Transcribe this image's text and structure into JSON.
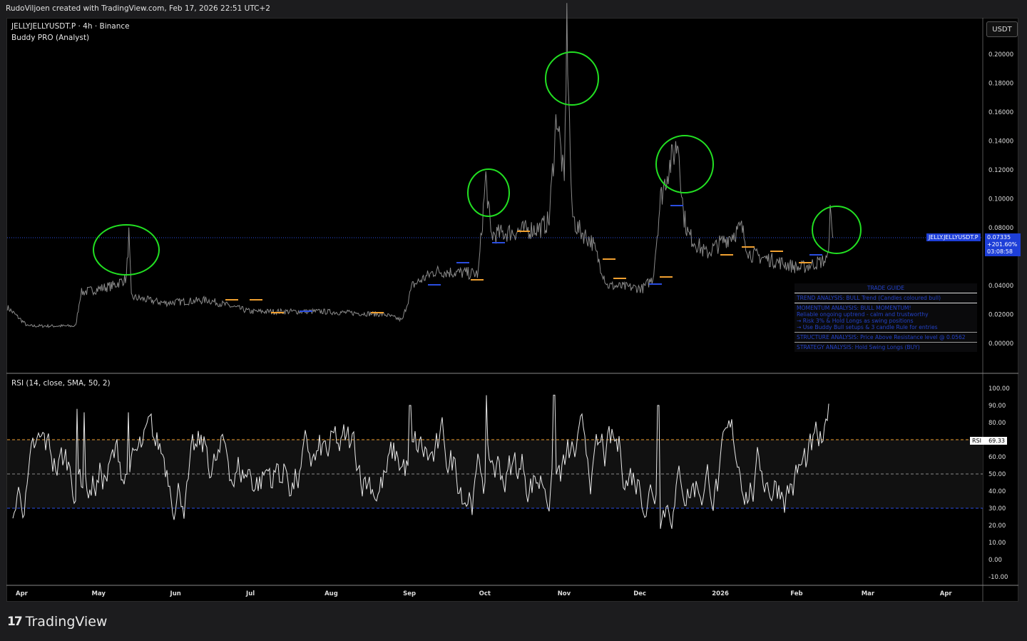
{
  "header": {
    "attribution": "RudoViljoen created with TradingView.com, Feb 17, 2026 22:51 UTC+2"
  },
  "chart": {
    "symbol_line": "JELLYJELLYUSDT.P · 4h · Binance",
    "indicator": "Buddy PRO (Analyst)",
    "currency_button": "USDT",
    "price_axis": [
      "0.20000",
      "0.18000",
      "0.16000",
      "0.14000",
      "0.12000",
      "0.10000",
      "0.08000",
      "0.04000",
      "0.02000",
      "0.00000"
    ],
    "price_tag": {
      "symbol": "JELLY.JELLYUSDT.P",
      "price": "0.07335",
      "change": "+201.60%",
      "countdown": "03:08:58"
    },
    "time_axis": [
      "Apr",
      "May",
      "Jun",
      "Jul",
      "Aug",
      "Sep",
      "Oct",
      "Nov",
      "Dec",
      "2026",
      "Feb",
      "Mar",
      "Apr"
    ],
    "colors": {
      "price_line": "#8a8a8a",
      "tag": "#1e3fd8",
      "circle": "#22e022",
      "orange": "#f0a030",
      "blue": "#2a4de0"
    }
  },
  "trade_guide": {
    "title": "TRADE GUIDE",
    "trend": "TREND ANALYSIS: BULL Trend (Candles coloured bull)",
    "momentum": [
      "MOMENTUM ANALYSIS: BULL MOMENTUM!",
      " Reliable ongoing uptrend - calm and trustworthy",
      "→ Risk 3% & Hold Longs as swing positions",
      "→ Use Buddy Bull setups & 3 candle Rule for entries"
    ],
    "structure": "STRUCTURE ANALYSIS: Price Above Resistance level @ 0.0562",
    "strategy": "STRATEGY ANALYSIS: Hold Swing Longs (BUY)"
  },
  "rsi": {
    "label": "RSI (14, close, SMA, 50, 2)",
    "axis": [
      "100.00",
      "90.00",
      "80.00",
      "60.00",
      "50.00",
      "40.00",
      "30.00",
      "20.00",
      "10.00",
      "0.00",
      "-10.00"
    ],
    "tag_label": "RSI",
    "tag_value": "69.33",
    "upper": 70,
    "middle": 50,
    "lower": 30
  },
  "chart_data": {
    "type": "line",
    "x_unit": "days since Apr 1 2025",
    "price_keypoints": [
      [
        -5,
        0.025
      ],
      [
        3,
        0.012
      ],
      [
        22,
        0.012
      ],
      [
        24,
        0.035
      ],
      [
        37,
        0.04
      ],
      [
        42,
        0.045
      ],
      [
        43,
        0.075
      ],
      [
        44,
        0.032
      ],
      [
        57,
        0.028
      ],
      [
        74,
        0.03
      ],
      [
        91,
        0.022
      ],
      [
        119,
        0.022
      ],
      [
        144,
        0.02
      ],
      [
        151,
        0.016
      ],
      [
        155,
        0.04
      ],
      [
        164,
        0.05
      ],
      [
        181,
        0.048
      ],
      [
        184,
        0.115
      ],
      [
        186,
        0.075
      ],
      [
        206,
        0.08
      ],
      [
        209,
        0.085
      ],
      [
        212,
        0.16
      ],
      [
        215,
        0.11
      ],
      [
        216,
        0.22
      ],
      [
        218,
        0.09
      ],
      [
        220,
        0.08
      ],
      [
        226,
        0.07
      ],
      [
        232,
        0.04
      ],
      [
        246,
        0.038
      ],
      [
        250,
        0.045
      ],
      [
        253,
        0.1
      ],
      [
        256,
        0.12
      ],
      [
        260,
        0.14
      ],
      [
        262,
        0.09
      ],
      [
        264,
        0.075
      ],
      [
        271,
        0.062
      ],
      [
        285,
        0.08
      ],
      [
        288,
        0.062
      ],
      [
        308,
        0.052
      ],
      [
        319,
        0.058
      ],
      [
        320,
        0.09
      ],
      [
        321,
        0.073
      ]
    ],
    "rsi_last": 69.33
  },
  "footer": {
    "brand": "TradingView"
  }
}
